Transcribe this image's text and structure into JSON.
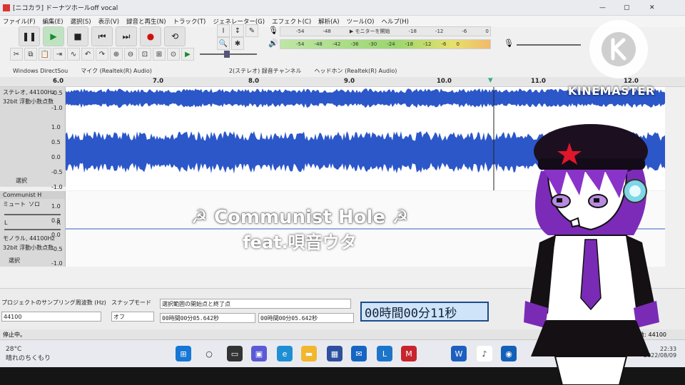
{
  "window": {
    "title": "[ニコカラ] ドーナツホールoff vocal"
  },
  "menu": [
    "ファイル(F)",
    "編集(E)",
    "選択(S)",
    "表示(V)",
    "録音と再生(N)",
    "トラック(T)",
    "ジェネレーター(G)",
    "エフェクト(C)",
    "解析(A)",
    "ツール(O)",
    "ヘルプ(H)"
  ],
  "meter": {
    "rec_scale": [
      "-54",
      "-48",
      "▶ モニターを開始",
      "-18",
      "-12",
      "-6",
      "0"
    ],
    "play_scale": [
      "-54",
      "-48",
      "-42",
      "-36",
      "-30",
      "-24",
      "-18",
      "-12",
      "-6",
      "0"
    ]
  },
  "devices": {
    "host": "Windows DirectSou",
    "mic": "マイク (Realtek(R) Audio)",
    "channels": "2(ステレオ) 録音チャンネル",
    "output": "ヘッドホン (Realtek(R) Audio)"
  },
  "ruler": [
    "6.0",
    "7.0",
    "8.0",
    "9.0",
    "10.0",
    "11.0",
    "12.0"
  ],
  "track1": {
    "info1": "ステレオ, 44100Hz",
    "info2": "32bit 浮動小数点数",
    "select": "選択",
    "scale_top": [
      "-0.5",
      "-1.0"
    ],
    "scale_bottom": [
      "1.0",
      "0.5",
      "0.0",
      "-0.5",
      "-1.0"
    ]
  },
  "track2": {
    "name": "Communist H",
    "mute": "ミュート",
    "solo": "ソロ",
    "l": "L",
    "r": "R",
    "info1": "モノラル, 44100Hz",
    "info2": "32bit 浮動小数点数",
    "select": "選択",
    "scale": [
      "1.0",
      "0.5",
      "0.0",
      "-0.5",
      "-1.0"
    ]
  },
  "bottom": {
    "rate_label": "プロジェクトのサンプリング周波数 (Hz)",
    "rate_value": "44100",
    "snap_label": "スナップモード",
    "snap_value": "オフ",
    "selection_label": "選択範囲の開始点と終了点",
    "sel_start": "00時間00分05.642秒",
    "sel_end": "00時間00分05.642秒",
    "position": "00時間00分11秒",
    "status": "停止中。",
    "actual_rate": "実際のサンプリング周波数: 44100"
  },
  "taskbar": {
    "weather_temp": "28°C",
    "weather_desc": "晴れのちくもり",
    "time": "22:33",
    "date": "2022/08/09"
  },
  "overlay": {
    "title": "☭ Communist Hole ☭",
    "subtitle": "feat.唄音ウタ",
    "watermark": "KINEMASTER"
  }
}
